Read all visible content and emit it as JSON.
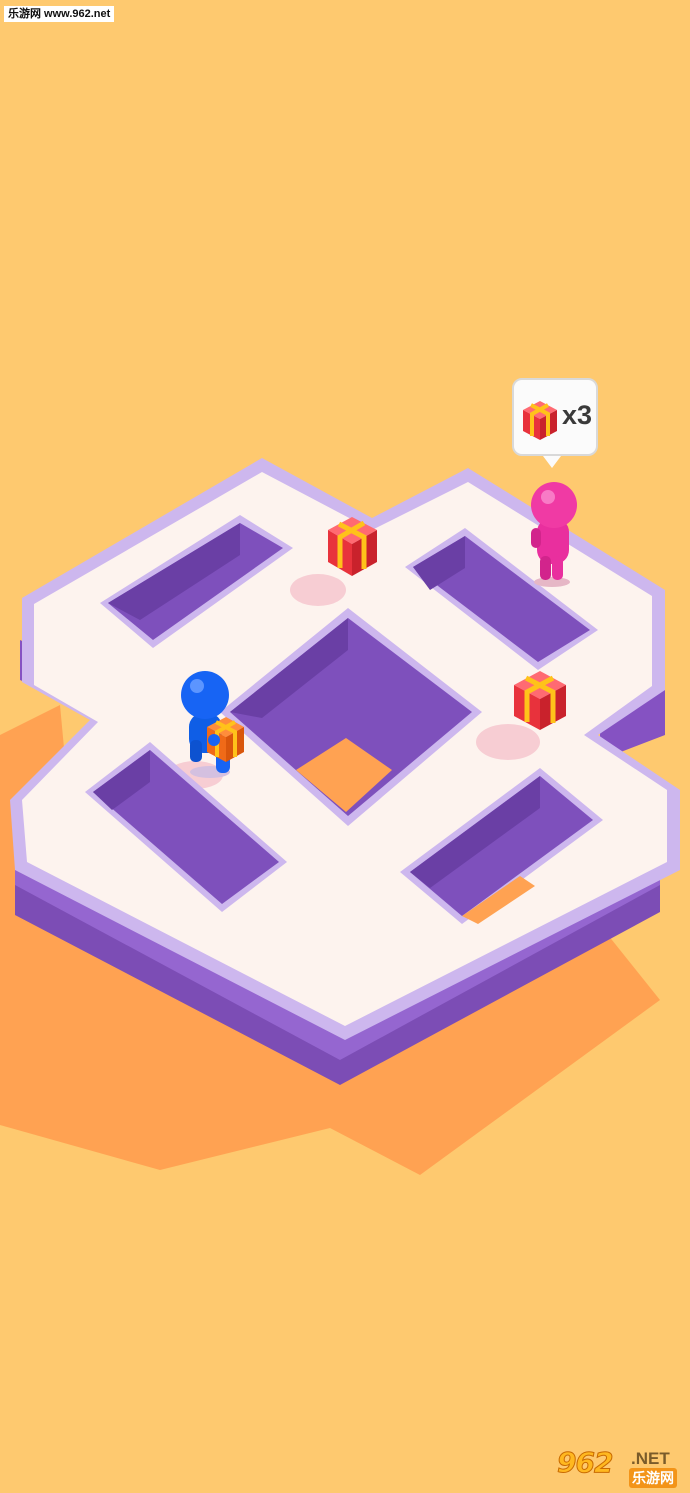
{
  "watermark": {
    "top_text": "乐游网 www.962.net",
    "logo_main": "962",
    "logo_net": ".NET",
    "logo_sub": "乐游网"
  },
  "hud": {
    "gift_counter": "x3"
  },
  "colors": {
    "background": "#fec96f",
    "shadow": "#ffa252",
    "path_top": "#fdf3ee",
    "wall_purple": "#8d5ec8",
    "rim": "#cdb7ee",
    "player_blue": "#1764f4",
    "rival_pink": "#f03aa4",
    "gift_red": "#f2424c",
    "ribbon_gold": "#ffc21a"
  }
}
